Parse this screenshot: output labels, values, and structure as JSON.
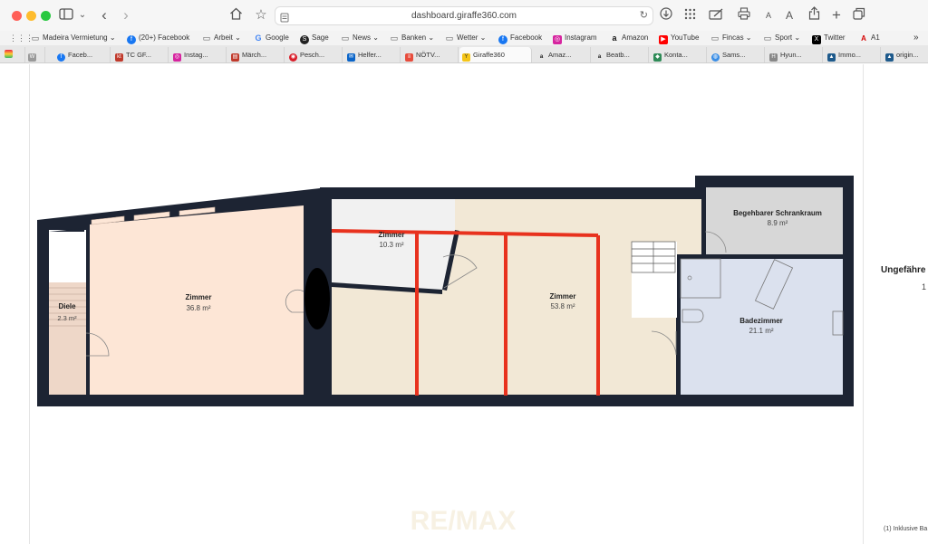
{
  "browser": {
    "url": "dashboard.giraffe360.com",
    "font_small": "A",
    "font_large": "A"
  },
  "favorites": [
    {
      "label": "Madeira Vermietung",
      "icon": "folder-icon"
    },
    {
      "label": "(20+) Facebook",
      "icon": "facebook-icon"
    },
    {
      "label": "Arbeit",
      "icon": "folder-icon"
    },
    {
      "label": "Google",
      "icon": "google-icon"
    },
    {
      "label": "Sage",
      "icon": "sage-icon"
    },
    {
      "label": "News",
      "icon": "folder-icon"
    },
    {
      "label": "Banken",
      "icon": "folder-icon"
    },
    {
      "label": "Wetter",
      "icon": "folder-icon"
    },
    {
      "label": "Facebook",
      "icon": "facebook-icon"
    },
    {
      "label": "Instagram",
      "icon": "instagram-icon"
    },
    {
      "label": "Amazon",
      "icon": "amazon-icon"
    },
    {
      "label": "YouTube",
      "icon": "youtube-icon"
    },
    {
      "label": "Fincas",
      "icon": "folder-icon"
    },
    {
      "label": "Sport",
      "icon": "folder-icon"
    },
    {
      "label": "Twitter",
      "icon": "x-icon"
    },
    {
      "label": "A1",
      "icon": "a1-icon"
    }
  ],
  "tabs": [
    {
      "label": "Faceb..."
    },
    {
      "label": "TC GF..."
    },
    {
      "label": "Instag..."
    },
    {
      "label": "Märch..."
    },
    {
      "label": "Pesch..."
    },
    {
      "label": "Helfer..."
    },
    {
      "label": "NÖTV..."
    },
    {
      "label": "Giraffe360"
    },
    {
      "label": "Amaz..."
    },
    {
      "label": "Beatb..."
    },
    {
      "label": "Konta..."
    },
    {
      "label": "Sams..."
    },
    {
      "label": "Hyun..."
    },
    {
      "label": "Immo..."
    },
    {
      "label": "origin..."
    }
  ],
  "floorplan": {
    "rooms": {
      "diele": {
        "name": "Diele",
        "area": "2.3 m²"
      },
      "zimmer_left": {
        "name": "Zimmer",
        "area": "36.8 m²"
      },
      "zimmer_small": {
        "name": "Zimmer",
        "area": "10.3 m²"
      },
      "zimmer_main": {
        "name": "Zimmer",
        "area": "53.8 m²"
      },
      "schrankraum": {
        "name": "Begehbarer Schrankraum",
        "area": "8.9 m²"
      },
      "badezimmer": {
        "name": "Badezimmer",
        "area": "21.1 m²"
      }
    },
    "watermark": "RE/MAX"
  },
  "sidebar": {
    "heading": "Ungefähre",
    "value": "1",
    "footnote": "(1) Inklusive Ba"
  }
}
